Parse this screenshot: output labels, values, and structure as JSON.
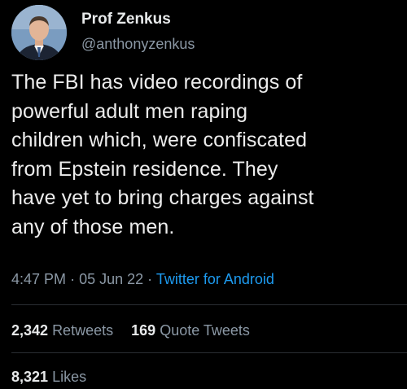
{
  "user": {
    "display_name": "Prof Zenkus",
    "handle": "@anthonyzenkus"
  },
  "tweet": {
    "text": "The FBI has video recordings of\npowerful adult men raping\nchildren which, were confiscated\nfrom Epstein residence. They\nhave yet to bring charges against\nany of those men.",
    "time": "4:47 PM",
    "date": "05 Jun 22",
    "separator": "·",
    "source": "Twitter for Android"
  },
  "stats": {
    "retweets_count": "2,342",
    "retweets_label": "Retweets",
    "quote_count": "169",
    "quote_label": "Quote Tweets",
    "likes_count": "8,321",
    "likes_label": "Likes"
  },
  "colors": {
    "background": "#000000",
    "text": "#e7e9ea",
    "secondary": "#8b98a5",
    "link": "#1d9bf0",
    "divider": "#2a2e33"
  }
}
